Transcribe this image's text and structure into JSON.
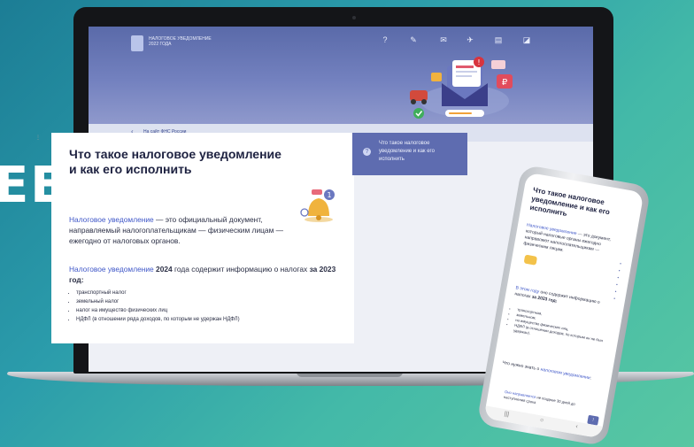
{
  "background_text": "ЕЕ",
  "site": {
    "brand_lines": [
      "Налоговое уведомление",
      "2022 года"
    ],
    "nav_icons": [
      "question-icon",
      "pen-icon",
      "mail-icon",
      "plane-icon",
      "chat-icon",
      "bubble-icon"
    ],
    "breadcrumb": {
      "chevron": "‹",
      "link": "На сайт ФНС России"
    }
  },
  "article": {
    "title": "Что такое налоговое уведомление и как его исполнить",
    "intro_link": "Налоговое уведомление",
    "intro_rest": " — это официальный документ, направляемый налогоплательщикам — физическим лицам — ежегодно от налоговых органов.",
    "second_link": "Налоговое уведомление",
    "second_year": " 2024",
    "second_rest": " года содержит информацию о налогах ",
    "second_bold": "за 2023 год:",
    "items": [
      "транспортный налог",
      "земельный налог",
      "налог на имущество физических лиц",
      "НДФЛ (в отношении ряда доходов, по которым не удержан НДФЛ)"
    ]
  },
  "sidebar": {
    "icon": "?",
    "text": "Что такое налоговое уведомление и как его исполнить"
  },
  "phone": {
    "title": "Что такое налоговое уведомление и как его исполнить",
    "p1_link": "Налоговое уведомление",
    "p1_rest": " — это документ, который налоговые органы ежегодно направляют налогоплательщикам — физическим лицам.",
    "p2_link": "В этом году",
    "p2_rest": " оно содержит информацию о налогах ",
    "p2_bold": "за 2023 год:",
    "items": [
      "транспортном,",
      "земельном,",
      "на имущество физических лиц,",
      "НДФЛ (в отношении доходов, по которым он не был удержан)."
    ],
    "p3_start": "Что нужно знать о ",
    "p3_link": "налоговом уведомлении",
    "p3_end": ":",
    "p4_link": "Оно направляется",
    "p4_rest": " не позднее 30 дней до наступления срока",
    "fab": "↑",
    "nav": [
      "|||",
      "○",
      "‹"
    ]
  }
}
